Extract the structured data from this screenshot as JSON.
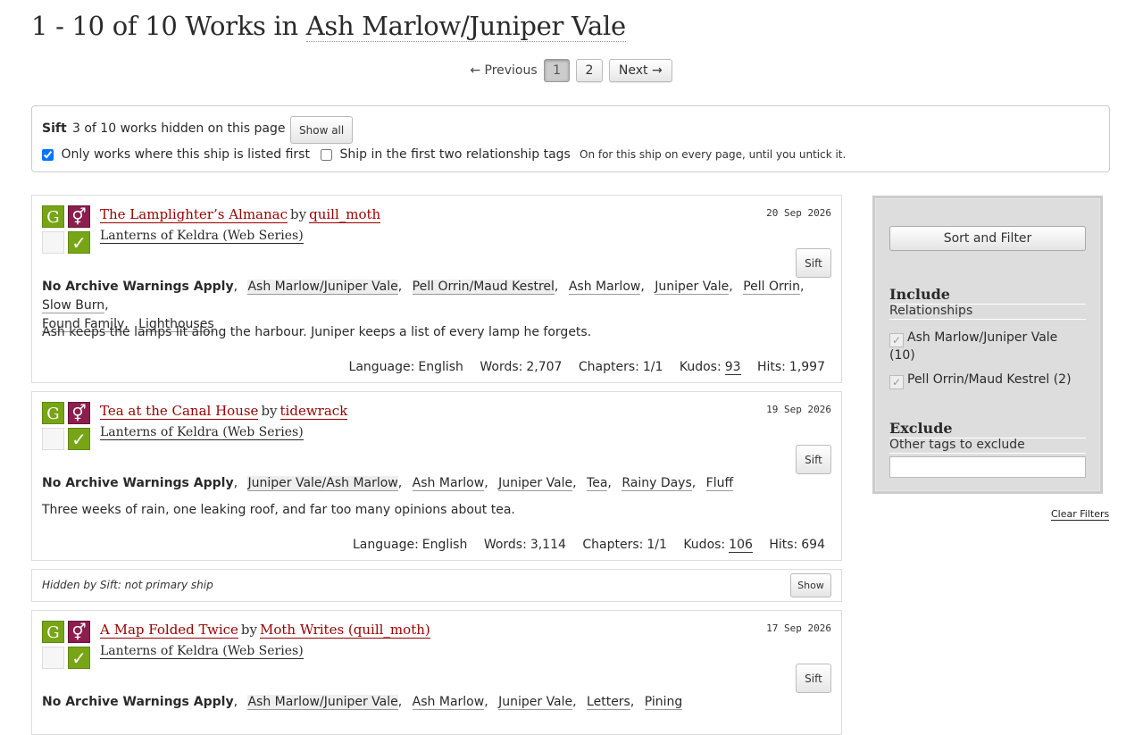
{
  "heading": {
    "prefix": "1 - 10 of 10 Works in",
    "ship": "Ash Marlow/Juniper Vale"
  },
  "pager": {
    "previous": "← Previous",
    "current": "1",
    "page2": "2",
    "next": "Next →"
  },
  "sift": {
    "title": "Sift",
    "count": "3 of 10 works hidden on this page",
    "show_all": "Show all",
    "option1": {
      "label": "Only works where this ship is listed first",
      "checked": true
    },
    "option2": {
      "label": "Ship in the first two relationship tags",
      "checked": false
    },
    "note": "On for this ship on every page, until you untick it."
  },
  "works": [
    {
      "title": "The Lamplighter’s Almanac",
      "by": "by",
      "author": "quill_moth",
      "fandom": "Lanterns of Keldra (Web Series)",
      "date": "20 Sep 2026",
      "sift": "Sift",
      "warning": "No Archive Warnings Apply",
      "relationships": [
        "Ash Marlow/Juniper Vale",
        "Pell Orrin/Maud Kestrel"
      ],
      "tags": [
        "Ash Marlow",
        "Juniper Vale",
        "Pell Orrin",
        "Slow Burn",
        "Found Family",
        "Lighthouses"
      ],
      "summary": "Ash keeps the lamps lit along the harbour. Juniper keeps a list of every lamp he forgets.",
      "stats": {
        "language_label": "Language:",
        "language": "English",
        "words_label": "Words:",
        "words": "2,707",
        "chapters_label": "Chapters:",
        "chapters": "1/1",
        "kudos_label": "Kudos:",
        "kudos": "93",
        "hits_label": "Hits:",
        "hits": "1,997"
      }
    },
    {
      "title": "Tea at the Canal House",
      "by": "by",
      "author": "tidewrack",
      "fandom": "Lanterns of Keldra (Web Series)",
      "date": "19 Sep 2026",
      "sift": "Sift",
      "warning": "No Archive Warnings Apply",
      "relationships": [
        "Juniper Vale/Ash Marlow"
      ],
      "tags": [
        "Ash Marlow",
        "Juniper Vale",
        "Tea",
        "Rainy Days",
        "Fluff"
      ],
      "summary": "Three weeks of rain, one leaking roof, and far too many opinions about tea.",
      "stats": {
        "language_label": "Language:",
        "language": "English",
        "words_label": "Words:",
        "words": "3,114",
        "chapters_label": "Chapters:",
        "chapters": "1/1",
        "kudos_label": "Kudos:",
        "kudos": "106",
        "hits_label": "Hits:",
        "hits": "694"
      }
    },
    {
      "title": "A Map Folded Twice",
      "by": "by",
      "author": "Moth Writes (quill_moth)",
      "fandom": "Lanterns of Keldra (Web Series)",
      "date": "17 Sep 2026",
      "sift": "Sift",
      "warning": "No Archive Warnings Apply",
      "relationships": [
        "Ash Marlow/Juniper Vale"
      ],
      "tags": [
        "Ash Marlow",
        "Juniper Vale",
        "Letters",
        "Pining"
      ]
    }
  ],
  "hidden": {
    "text": "Hidden by Sift: not primary ship",
    "show": "Show"
  },
  "icons": {
    "rating": "G",
    "category": "⚥",
    "complete": "✓"
  },
  "filters": {
    "sort_button": "Sort and Filter",
    "include": "Include",
    "relationships": "Relationships",
    "options": [
      "Ash Marlow/Juniper Vale (10)",
      "Pell Orrin/Maud Kestrel (2)"
    ],
    "exclude": "Exclude",
    "exclude_label": "Other tags to exclude",
    "exclude_value": "",
    "clear": "Clear Filters"
  }
}
